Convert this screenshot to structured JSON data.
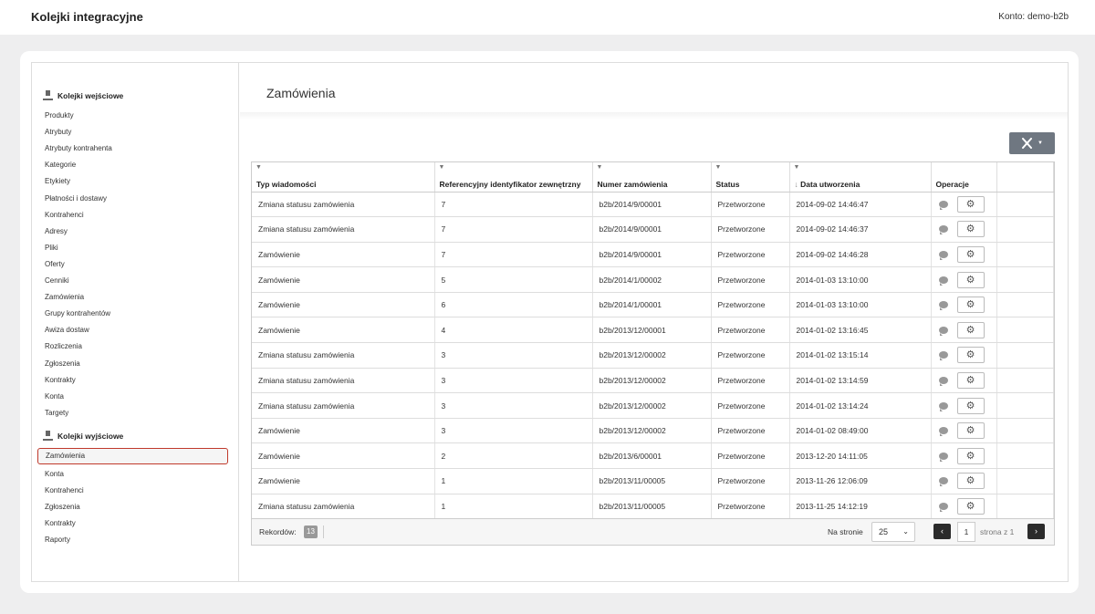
{
  "header": {
    "title": "Kolejki integracyjne",
    "account": "Konto: demo-b2b"
  },
  "sidebar": {
    "inbound_title": "Kolejki wejściowe",
    "inbound": [
      "Produkty",
      "Atrybuty",
      "Atrybuty kontrahenta",
      "Kategorie",
      "Etykiety",
      "Płatności i dostawy",
      "Kontrahenci",
      "Adresy",
      "Pliki",
      "Oferty",
      "Cenniki",
      "Zamówienia",
      "Grupy kontrahentów",
      "Awiza dostaw",
      "Rozliczenia",
      "Zgłoszenia",
      "Kontrakty",
      "Konta",
      "Targety"
    ],
    "outbound_title": "Kolejki wyjściowe",
    "outbound": [
      "Zamówienia",
      "Konta",
      "Kontrahenci",
      "Zgłoszenia",
      "Kontrakty",
      "Raporty"
    ],
    "active": "Zamówienia"
  },
  "main": {
    "title": "Zamówienia"
  },
  "toolbar": {
    "tools_icon": "tools-icon"
  },
  "table": {
    "columns": [
      "Typ wiadomości",
      "Referencyjny identyfikator zewnętrzny",
      "Numer zamówienia",
      "Status",
      "Data utworzenia",
      "Operacje"
    ],
    "sort_column": "Data utworzenia",
    "rows": [
      [
        "Zmiana statusu zamówienia",
        "7",
        "b2b/2014/9/00001",
        "Przetworzone",
        "2014-09-02 14:46:47"
      ],
      [
        "Zmiana statusu zamówienia",
        "7",
        "b2b/2014/9/00001",
        "Przetworzone",
        "2014-09-02 14:46:37"
      ],
      [
        "Zamówienie",
        "7",
        "b2b/2014/9/00001",
        "Przetworzone",
        "2014-09-02 14:46:28"
      ],
      [
        "Zamówienie",
        "5",
        "b2b/2014/1/00002",
        "Przetworzone",
        "2014-01-03 13:10:00"
      ],
      [
        "Zamówienie",
        "6",
        "b2b/2014/1/00001",
        "Przetworzone",
        "2014-01-03 13:10:00"
      ],
      [
        "Zamówienie",
        "4",
        "b2b/2013/12/00001",
        "Przetworzone",
        "2014-01-02 13:16:45"
      ],
      [
        "Zmiana statusu zamówienia",
        "3",
        "b2b/2013/12/00002",
        "Przetworzone",
        "2014-01-02 13:15:14"
      ],
      [
        "Zmiana statusu zamówienia",
        "3",
        "b2b/2013/12/00002",
        "Przetworzone",
        "2014-01-02 13:14:59"
      ],
      [
        "Zmiana statusu zamówienia",
        "3",
        "b2b/2013/12/00002",
        "Przetworzone",
        "2014-01-02 13:14:24"
      ],
      [
        "Zamówienie",
        "3",
        "b2b/2013/12/00002",
        "Przetworzone",
        "2014-01-02 08:49:00"
      ],
      [
        "Zamówienie",
        "2",
        "b2b/2013/6/00001",
        "Przetworzone",
        "2013-12-20 14:11:05"
      ],
      [
        "Zamówienie",
        "1",
        "b2b/2013/11/00005",
        "Przetworzone",
        "2013-11-26 12:06:09"
      ],
      [
        "Zmiana statusu zamówienia",
        "1",
        "b2b/2013/11/00005",
        "Przetworzone",
        "2013-11-25 14:12:19"
      ]
    ]
  },
  "footer": {
    "records_label": "Rekordów:",
    "records_count": "13",
    "per_page_label": "Na stronie",
    "per_page_value": "25",
    "page_value": "1",
    "page_of": "strona z 1"
  }
}
